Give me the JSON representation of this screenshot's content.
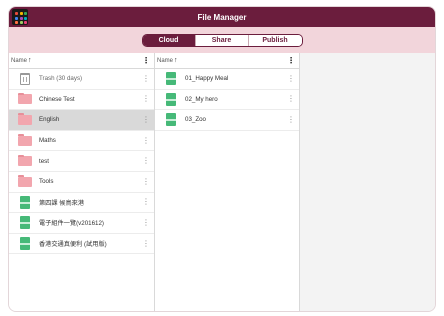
{
  "titlebar": {
    "title": "File Manager"
  },
  "tabs": [
    {
      "label": "Cloud",
      "active": true
    },
    {
      "label": "Share",
      "active": false
    },
    {
      "label": "Publish",
      "active": false
    }
  ],
  "pane1": {
    "header": {
      "label": "Name",
      "sort_arrow": "↑",
      "menu": "⋮"
    },
    "items": [
      {
        "label": "Trash (30 days)",
        "icon": "trash-icon",
        "menu": "⋮"
      },
      {
        "label": "Chinese Test",
        "icon": "folder-icon",
        "menu": "⋮"
      },
      {
        "label": "English",
        "icon": "folder-icon",
        "menu": "⋮",
        "selected": true
      },
      {
        "label": "Maths",
        "icon": "folder-icon",
        "menu": "⋮"
      },
      {
        "label": "test",
        "icon": "folder-icon",
        "menu": "⋮"
      },
      {
        "label": "Tools",
        "icon": "folder-icon",
        "menu": "⋮"
      },
      {
        "label": "第四課 候鳥來港",
        "icon": "book-icon",
        "menu": "⋮"
      },
      {
        "label": "電子組件一覽(v201612)",
        "icon": "book-icon",
        "menu": "⋮"
      },
      {
        "label": "香港交通真便利 (試用版)",
        "icon": "book-icon",
        "menu": "⋮"
      }
    ]
  },
  "pane2": {
    "header": {
      "label": "Name",
      "sort_arrow": "↑",
      "menu": "⋮"
    },
    "items": [
      {
        "label": "01_Happy Meal",
        "icon": "book-icon",
        "menu": "⋮"
      },
      {
        "label": "02_My hero",
        "icon": "book-icon",
        "menu": "⋮"
      },
      {
        "label": "03_Zoo",
        "icon": "book-icon",
        "menu": "⋮"
      }
    ]
  },
  "colors": {
    "titlebar": "#6b1d3d",
    "tabbar": "#f2d5db",
    "folder": "#f2a6ae",
    "book": "#46b978",
    "selected_row": "#d9d9d9"
  }
}
